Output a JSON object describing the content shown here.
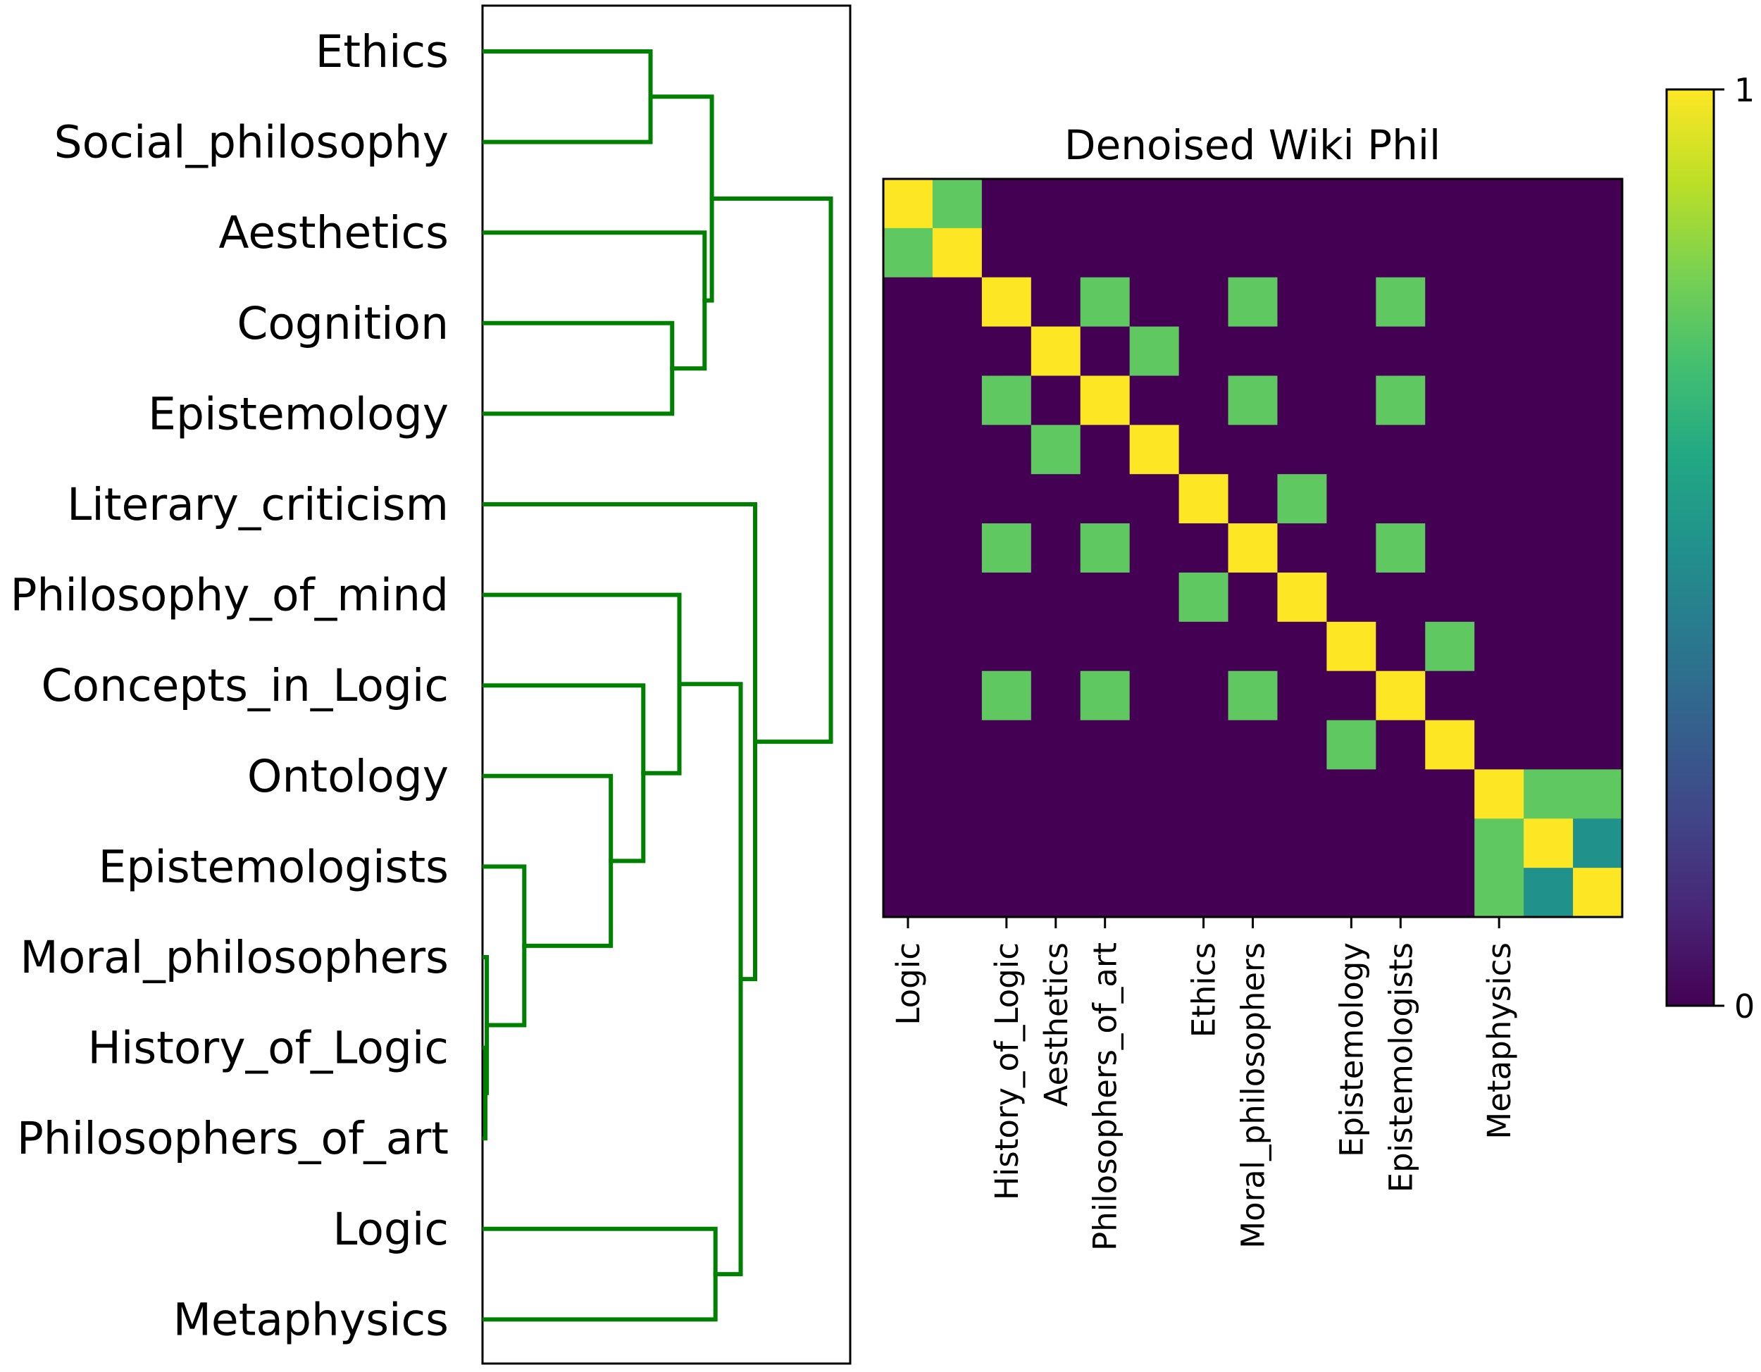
{
  "chart_data": [
    {
      "type": "dendrogram",
      "orientation": "left",
      "leaves": [
        "Ethics",
        "Social_philosophy",
        "Aesthetics",
        "Cognition",
        "Epistemology",
        "Literary_criticism",
        "Philosophy_of_mind",
        "Concepts_in_Logic",
        "Ontology",
        "Epistemologists",
        "Moral_philosophers",
        "History_of_Logic",
        "Philosophers_of_art",
        "Logic",
        "Metaphysics"
      ],
      "link_color": "#008000",
      "merges": [
        {
          "id": "m_hist_art",
          "children": [
            "History_of_Logic",
            "Philosophers_of_art"
          ],
          "height": 0.002
        },
        {
          "id": "m_moral",
          "children": [
            "Moral_philosophers",
            "m_hist_art"
          ],
          "height": 0.006
        },
        {
          "id": "m_epistgists",
          "children": [
            "Epistemologists",
            "m_moral"
          ],
          "height": 0.11
        },
        {
          "id": "m_ontology",
          "children": [
            "Ontology",
            "m_epistgists"
          ],
          "height": 0.35
        },
        {
          "id": "m_concepts",
          "children": [
            "Concepts_in_Logic",
            "m_ontology"
          ],
          "height": 0.44
        },
        {
          "id": "m_mind",
          "children": [
            "Philosophy_of_mind",
            "m_concepts"
          ],
          "height": 0.54
        },
        {
          "id": "m_logic_meta",
          "children": [
            "Logic",
            "Metaphysics"
          ],
          "height": 0.64
        },
        {
          "id": "m_lower",
          "children": [
            "m_mind",
            "m_logic_meta"
          ],
          "height": 0.71
        },
        {
          "id": "m_literary",
          "children": [
            "Literary_criticism",
            "m_lower"
          ],
          "height": 0.75
        },
        {
          "id": "m_ethics_social",
          "children": [
            "Ethics",
            "Social_philosophy"
          ],
          "height": 0.46
        },
        {
          "id": "m_cog_epist",
          "children": [
            "Cognition",
            "Epistemology"
          ],
          "height": 0.52
        },
        {
          "id": "m_aesth",
          "children": [
            "Aesthetics",
            "m_cog_epist"
          ],
          "height": 0.61
        },
        {
          "id": "m_upper",
          "children": [
            "m_ethics_social",
            "m_aesth"
          ],
          "height": 0.63
        },
        {
          "id": "m_root",
          "children": [
            "m_upper",
            "m_literary"
          ],
          "height": 0.96
        }
      ],
      "height_range": [
        0,
        1
      ]
    },
    {
      "type": "heatmap",
      "title": "Denoised Wiki Phil",
      "size": 15,
      "xtick_labels": [
        {
          "index": 0,
          "label": "Logic"
        },
        {
          "index": 2,
          "label": "History_of_Logic"
        },
        {
          "index": 3,
          "label": "Aesthetics"
        },
        {
          "index": 4,
          "label": "Philosophers_of_art"
        },
        {
          "index": 6,
          "label": "Ethics"
        },
        {
          "index": 7,
          "label": "Moral_philosophers"
        },
        {
          "index": 9,
          "label": "Epistemology"
        },
        {
          "index": 10,
          "label": "Epistemologists"
        },
        {
          "index": 12,
          "label": "Metaphysics"
        }
      ],
      "colormap": "viridis",
      "vmin": 0,
      "vmax": 1,
      "colorbar": {
        "ticks": [
          0,
          1
        ],
        "tick_labels": [
          "0",
          "1"
        ]
      },
      "matrix": [
        [
          1,
          0.75,
          0,
          0,
          0,
          0,
          0,
          0,
          0,
          0,
          0,
          0,
          0,
          0,
          0
        ],
        [
          0.75,
          1,
          0,
          0,
          0,
          0,
          0,
          0,
          0,
          0,
          0,
          0,
          0,
          0,
          0
        ],
        [
          0,
          0,
          1,
          0,
          0.75,
          0,
          0,
          0.75,
          0,
          0,
          0.75,
          0,
          0,
          0,
          0
        ],
        [
          0,
          0,
          0,
          1,
          0,
          0.75,
          0,
          0,
          0,
          0,
          0,
          0,
          0,
          0,
          0
        ],
        [
          0,
          0,
          0.75,
          0,
          1,
          0,
          0,
          0.75,
          0,
          0,
          0.75,
          0,
          0,
          0,
          0
        ],
        [
          0,
          0,
          0,
          0.75,
          0,
          1,
          0,
          0,
          0,
          0,
          0,
          0,
          0,
          0,
          0
        ],
        [
          0,
          0,
          0,
          0,
          0,
          0,
          1,
          0,
          0.75,
          0,
          0,
          0,
          0,
          0,
          0
        ],
        [
          0,
          0,
          0.75,
          0,
          0.75,
          0,
          0,
          1,
          0,
          0,
          0.75,
          0,
          0,
          0,
          0
        ],
        [
          0,
          0,
          0,
          0,
          0,
          0,
          0.75,
          0,
          1,
          0,
          0,
          0,
          0,
          0,
          0
        ],
        [
          0,
          0,
          0,
          0,
          0,
          0,
          0,
          0,
          0,
          1,
          0,
          0.75,
          0,
          0,
          0
        ],
        [
          0,
          0,
          0.75,
          0,
          0.75,
          0,
          0,
          0.75,
          0,
          0,
          1,
          0,
          0,
          0,
          0
        ],
        [
          0,
          0,
          0,
          0,
          0,
          0,
          0,
          0,
          0,
          0.75,
          0,
          1,
          0,
          0,
          0
        ],
        [
          0,
          0,
          0,
          0,
          0,
          0,
          0,
          0,
          0,
          0,
          0,
          0,
          1,
          0.75,
          0.75
        ],
        [
          0,
          0,
          0,
          0,
          0,
          0,
          0,
          0,
          0,
          0,
          0,
          0,
          0.75,
          1,
          0.5
        ],
        [
          0,
          0,
          0,
          0,
          0,
          0,
          0,
          0,
          0,
          0,
          0,
          0,
          0.75,
          0.5,
          1
        ]
      ]
    }
  ]
}
